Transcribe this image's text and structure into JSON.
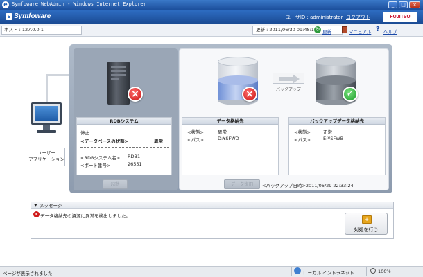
{
  "window": {
    "title": "Symfoware WebAdmin - Windows Internet Explorer",
    "minimize": "_",
    "maximize": "□",
    "close": "×"
  },
  "header": {
    "logo": "Symfoware",
    "user": "ユーザID : administrator",
    "logout": "ログアウト",
    "brand": "FUJITSU"
  },
  "toolbar": {
    "host": "ホスト : 127.0.0.1",
    "updated": "更新 : 2011/06/30 09:48:13",
    "refresh": "更新",
    "manual": "マニュアル",
    "help": "ヘルプ"
  },
  "user_app": {
    "label_line1": "ユーザー",
    "label_line2": "アプリケーション"
  },
  "rdb": {
    "header": "RDBシステム",
    "status": "停止",
    "db_state_label": "<データベースの状態>",
    "db_state_value": "異常",
    "system_name_label": "<RDBシステム名>",
    "system_name_value": "RDB1",
    "port_label": "<ポート番号>",
    "port_value": "26551",
    "start_button": "起動"
  },
  "backup_flow": {
    "label": "バックアップ"
  },
  "data_store": {
    "header": "データ格納先",
    "state_label": "<状態>",
    "state_value": "異常",
    "path_label": "<パス>",
    "path_value": "D:¥SFWD"
  },
  "backup_store": {
    "header": "バックアップデータ格納先",
    "state_label": "<状態>",
    "state_value": "正常",
    "path_label": "<パス>",
    "path_value": "E:¥SFWB"
  },
  "recovery": {
    "button": "データ復旧",
    "backup_datetime": "<バックアップ日時>2011/06/29 22:33:24"
  },
  "messages": {
    "header": "メッセージ",
    "text": "データ格納先の資源に異常を検出しました。",
    "action_button": "対処を行う"
  },
  "statusbar": {
    "left": "ページが表示されました",
    "zone": "ローカル イントラネット",
    "zoom": "100%"
  },
  "colors": {
    "error": "#c81313",
    "ok": "#1c9a2a",
    "header_blue": "#2f6ec4"
  }
}
